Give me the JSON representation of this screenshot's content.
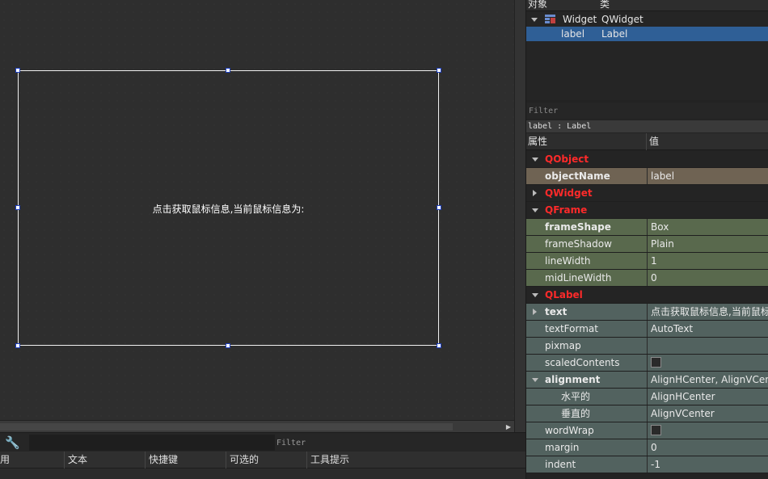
{
  "form_editor": {
    "label_text": "点击获取鼠标信息,当前鼠标信息为:"
  },
  "action_editor": {
    "filter_placeholder": "Filter",
    "columns": [
      "用",
      "文本",
      "快捷键",
      "可选的",
      "工具提示"
    ]
  },
  "object_inspector": {
    "headers": {
      "object": "对象",
      "class": "类"
    },
    "rows": [
      {
        "name": "Widget",
        "class": "QWidget"
      },
      {
        "name": "label",
        "class": "Label"
      }
    ]
  },
  "property_editor": {
    "filter_placeholder": "Filter",
    "current_object": "label : Label",
    "headers": {
      "property": "属性",
      "value": "值"
    },
    "groups": {
      "qobject": "QObject",
      "qwidget": "QWidget",
      "qframe": "QFrame",
      "qlabel": "QLabel"
    },
    "properties": {
      "objectName": {
        "name": "objectName",
        "value": "label"
      },
      "frameShape": {
        "name": "frameShape",
        "value": "Box"
      },
      "frameShadow": {
        "name": "frameShadow",
        "value": "Plain"
      },
      "lineWidth": {
        "name": "lineWidth",
        "value": "1"
      },
      "midLineWidth": {
        "name": "midLineWidth",
        "value": "0"
      },
      "text": {
        "name": "text",
        "value": "点击获取鼠标信息,当前鼠标信息为:"
      },
      "textFormat": {
        "name": "textFormat",
        "value": "AutoText"
      },
      "pixmap": {
        "name": "pixmap",
        "value": ""
      },
      "scaledContents": {
        "name": "scaledContents",
        "checked": false
      },
      "alignment": {
        "name": "alignment",
        "value": "AlignHCenter, AlignVCenter"
      },
      "alignment_h": {
        "name": "水平的",
        "value": "AlignHCenter"
      },
      "alignment_v": {
        "name": "垂直的",
        "value": "AlignVCenter"
      },
      "wordWrap": {
        "name": "wordWrap",
        "checked": false
      },
      "margin": {
        "name": "margin",
        "value": "0"
      },
      "indent": {
        "name": "indent",
        "value": "-1"
      }
    }
  }
}
